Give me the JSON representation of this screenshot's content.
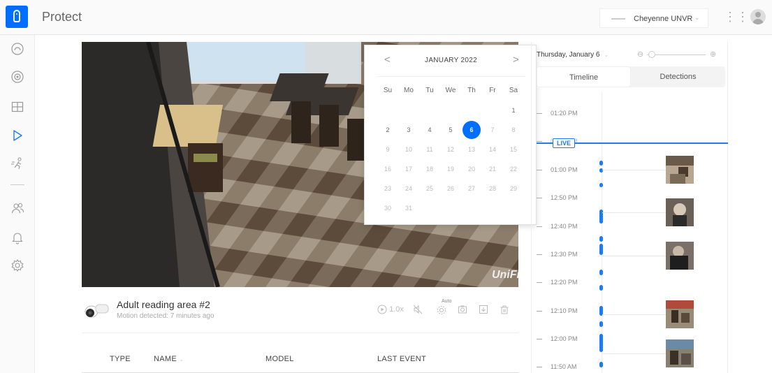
{
  "app": {
    "title": "Protect"
  },
  "header": {
    "console_name": "Cheyenne UNVR"
  },
  "sidebar": {
    "items": [
      {
        "name": "dashboard-icon"
      },
      {
        "name": "devices-icon"
      },
      {
        "name": "liveview-icon"
      },
      {
        "name": "timelapse-icon",
        "active": true
      },
      {
        "name": "detections-icon"
      },
      {
        "name": "users-icon"
      },
      {
        "name": "alerts-icon"
      },
      {
        "name": "settings-icon"
      }
    ]
  },
  "calendar": {
    "month": "JANUARY 2022",
    "weekdays": [
      "Su",
      "Mo",
      "Tu",
      "We",
      "Th",
      "Fr",
      "Sa"
    ],
    "weeks": [
      [
        "",
        "",
        "",
        "",
        "",
        "",
        "1"
      ],
      [
        "2",
        "3",
        "4",
        "5",
        "6",
        "7",
        "8"
      ],
      [
        "9",
        "10",
        "11",
        "12",
        "13",
        "14",
        "15"
      ],
      [
        "16",
        "17",
        "18",
        "19",
        "20",
        "21",
        "22"
      ],
      [
        "23",
        "24",
        "25",
        "26",
        "27",
        "28",
        "29"
      ],
      [
        "30",
        "31",
        "",
        "",
        "",
        "",
        ""
      ]
    ],
    "selected": "6",
    "enabled": [
      "1",
      "2",
      "3",
      "4",
      "5",
      "6"
    ]
  },
  "camera": {
    "title": "Adult reading area #2",
    "subtitle": "Motion detected: 7 minutes ago",
    "speed": "1.0x",
    "auto_label": "Auto",
    "watermark": "UniFi"
  },
  "table": {
    "headers": [
      "TYPE",
      "NAME",
      "MODEL",
      "LAST EVENT"
    ]
  },
  "timeline": {
    "date": "Thursday, January 6",
    "tabs": [
      "Timeline",
      "Detections"
    ],
    "selected_tab": "Timeline",
    "live_label": "LIVE",
    "times": [
      "01:20 PM",
      "01:10 PM",
      "01:00 PM",
      "12:50 PM",
      "12:40 PM",
      "12:30 PM",
      "12:20 PM",
      "12:10 PM",
      "12:00 PM",
      "11:50 AM"
    ]
  },
  "colors": {
    "accent": "#006fff",
    "live": "#1c7cf4"
  }
}
